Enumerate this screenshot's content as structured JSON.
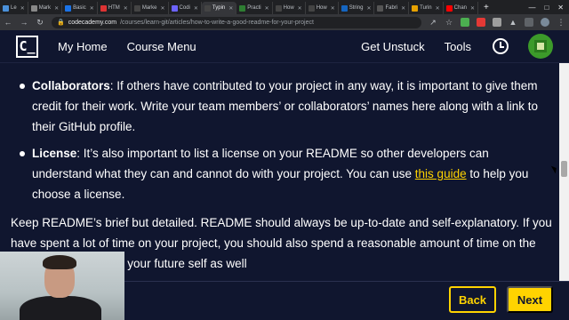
{
  "browser": {
    "tabs": [
      {
        "label": "Le",
        "color": "#4a90d9",
        "active": false
      },
      {
        "label": "Mark",
        "color": "#888888",
        "active": false
      },
      {
        "label": "Basic",
        "color": "#1a73e8",
        "active": false
      },
      {
        "label": "HTM",
        "color": "#d33",
        "active": false
      },
      {
        "label": "Marke",
        "color": "#444444",
        "active": false
      },
      {
        "label": "Codi",
        "color": "#6c63ff",
        "active": false
      },
      {
        "label": "Typin",
        "color": "#444444",
        "active": true
      },
      {
        "label": "Practi",
        "color": "#2e7d32",
        "active": false
      },
      {
        "label": "How",
        "color": "#444444",
        "active": false
      },
      {
        "label": "How",
        "color": "#444444",
        "active": false
      },
      {
        "label": "String",
        "color": "#1565c0",
        "active": false
      },
      {
        "label": "Fabri",
        "color": "#555555",
        "active": false
      },
      {
        "label": "Turin",
        "color": "#e6a100",
        "active": false
      },
      {
        "label": "Chan",
        "color": "#ff0000",
        "active": false
      }
    ],
    "new_tab": "+",
    "url_host": "codecademy.com",
    "url_path": "/courses/learn-git/articles/how-to-write-a-good-readme-for-your-project"
  },
  "header": {
    "logo": "C_",
    "my_home": "My Home",
    "course_menu": "Course Menu",
    "get_unstuck": "Get Unstuck",
    "tools": "Tools"
  },
  "article": {
    "bullets": [
      {
        "title": "Collaborators",
        "text": ": If others have contributed to your project in any way, it is important to give them credit for their work. Write your team members’ or collaborators’ names here along with a link to their GitHub profile."
      },
      {
        "title": "License",
        "text_before": ": It’s also important to list a license on your README so other developers can understand what they can and cannot do with your project. You can use ",
        "link": "this guide",
        "text_after": " to help you choose a license."
      }
    ],
    "paragraph": "Keep README’s brief but detailed. README should always be up-to-date and self-explanatory. If you have spent a lot of time on your project, you should also spend a reasonable amount of time on the README. It can help your future self as well"
  },
  "footer": {
    "back": "Back",
    "next": "Next"
  },
  "colors": {
    "background": "#10162f",
    "accent": "#ffd300",
    "text": "#ffffff"
  }
}
